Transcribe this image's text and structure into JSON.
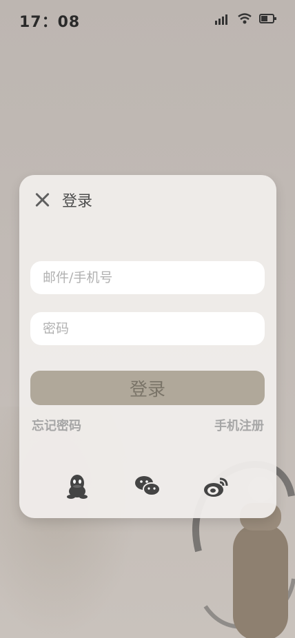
{
  "status": {
    "time": "17：08"
  },
  "dialog": {
    "title": "登录",
    "email_placeholder": "邮件/手机号",
    "password_placeholder": "密码",
    "login_button": "登录",
    "forgot_password": "忘记密码",
    "phone_register": "手机注册",
    "social": [
      {
        "icon": "qq-icon"
      },
      {
        "icon": "wechat-icon"
      },
      {
        "icon": "weibo-icon"
      }
    ]
  },
  "colors": {
    "accent": "#b0a89a",
    "card_bg": "#f0edeb",
    "background": "#bfb8b3"
  }
}
